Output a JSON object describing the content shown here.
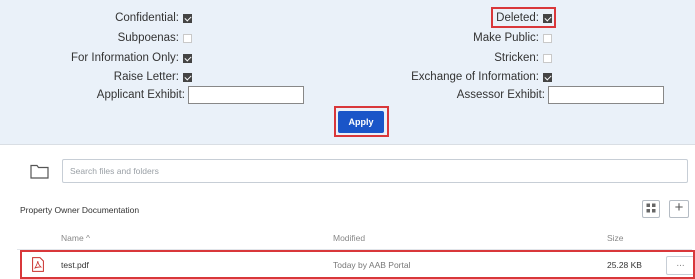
{
  "filters": {
    "left": [
      {
        "label": "Confidential:",
        "checked": true
      },
      {
        "label": "Subpoenas:",
        "checked": false
      },
      {
        "label": "For Information Only:",
        "checked": true
      },
      {
        "label": "Raise Letter:",
        "checked": true
      }
    ],
    "right": [
      {
        "label": "Deleted:",
        "checked": true
      },
      {
        "label": "Make Public:",
        "checked": false
      },
      {
        "label": "Stricken:",
        "checked": false
      },
      {
        "label": "Exchange of Information:",
        "checked": true
      }
    ],
    "applicant_exhibit": {
      "label": "Applicant Exhibit:",
      "value": ""
    },
    "assessor_exhibit": {
      "label": "Assessor Exhibit:",
      "value": ""
    },
    "apply_label": "Apply"
  },
  "files": {
    "search_placeholder": "Search files and folders",
    "section_title": "Property Owner Documentation",
    "columns": {
      "name": "Name ^",
      "modified": "Modified",
      "size": "Size"
    },
    "rows": [
      {
        "name": "test.pdf",
        "modified": "Today by AAB Portal",
        "size": "25.28 KB",
        "more": "..."
      }
    ],
    "add_label": "+"
  },
  "colors": {
    "highlight": "#d9373a",
    "primary": "#1a55c8",
    "panel_bg": "#eaf1f9"
  }
}
